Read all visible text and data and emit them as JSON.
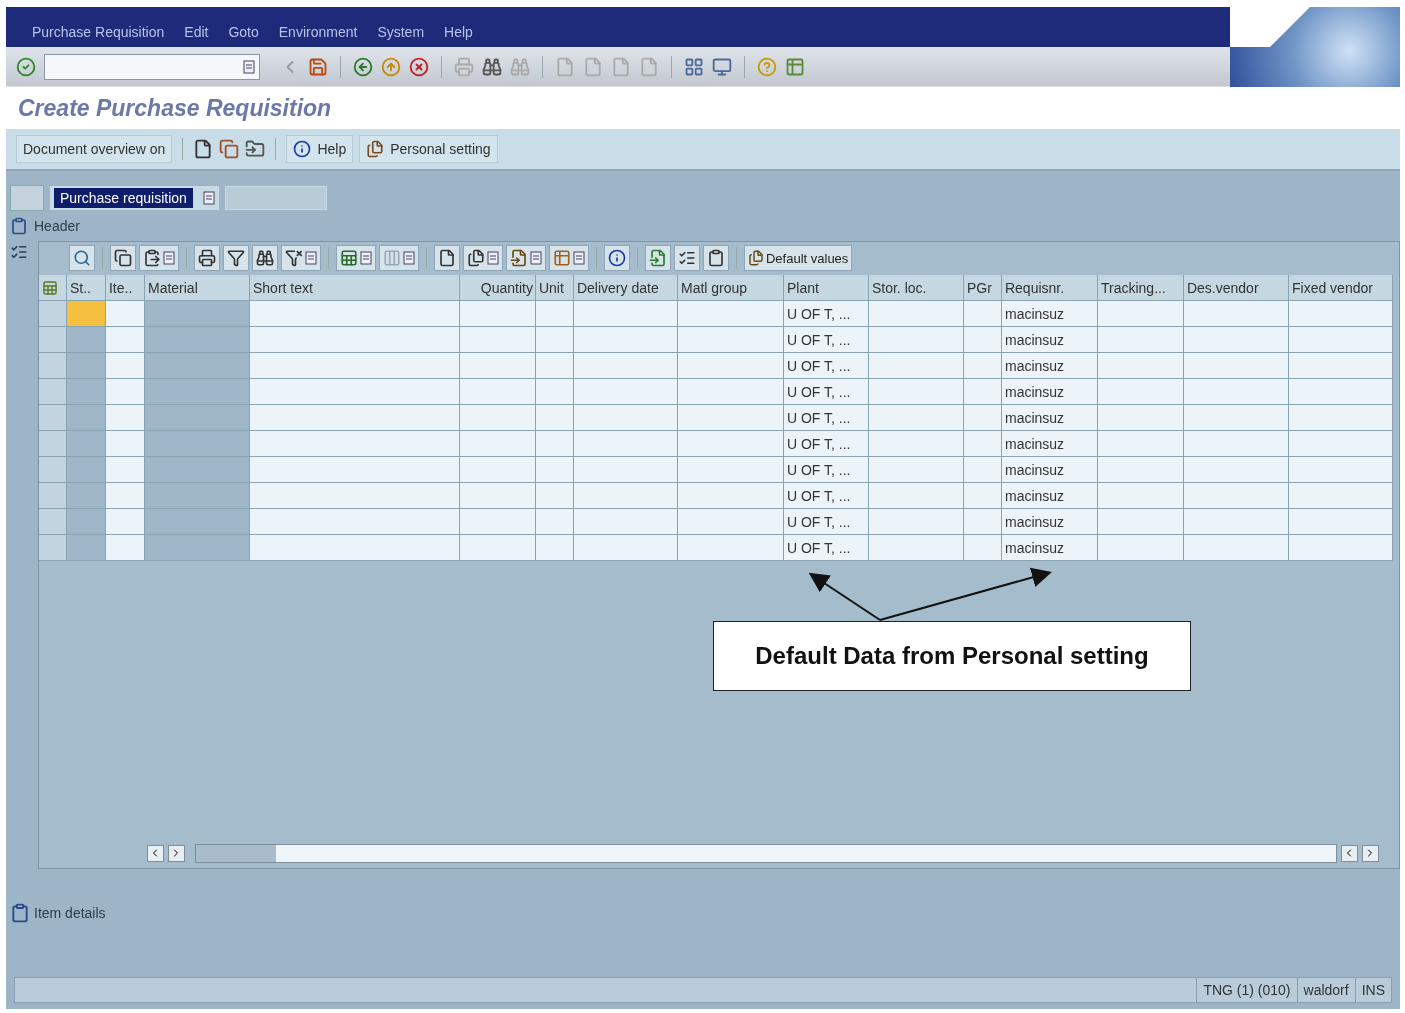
{
  "menu": [
    "Purchase Requisition",
    "Edit",
    "Goto",
    "Environment",
    "System",
    "Help"
  ],
  "title": "Create Purchase Requisition",
  "app_toolbar": {
    "overview_button": "Document overview on",
    "help_button": "Help",
    "personal_button": "Personal setting"
  },
  "document_type": {
    "value": "Purchase requisition"
  },
  "header_label": "Header",
  "table_toolbar": {
    "default_values_button": "Default values"
  },
  "table": {
    "columns": [
      {
        "label": "St..",
        "editable": false,
        "kind": "blank"
      },
      {
        "label": "Ite..",
        "editable": true,
        "kind": "blank"
      },
      {
        "label": "Material",
        "editable": false,
        "kind": "blank"
      },
      {
        "label": "Short text",
        "editable": true,
        "kind": "blank"
      },
      {
        "label": "Quantity",
        "editable": true,
        "kind": "blank"
      },
      {
        "label": "Unit",
        "editable": true,
        "kind": "blank"
      },
      {
        "label": "Delivery date",
        "editable": true,
        "kind": "blank"
      },
      {
        "label": "Matl group",
        "editable": true,
        "kind": "blank"
      },
      {
        "label": "Plant",
        "editable": true,
        "kind": "plant"
      },
      {
        "label": "Stor. loc.",
        "editable": true,
        "kind": "blank"
      },
      {
        "label": "PGr",
        "editable": true,
        "kind": "blank"
      },
      {
        "label": "Requisnr.",
        "editable": true,
        "kind": "requisnr"
      },
      {
        "label": "Tracking...",
        "editable": true,
        "kind": "blank"
      },
      {
        "label": "Des.vendor",
        "editable": true,
        "kind": "blank"
      },
      {
        "label": "Fixed vendor",
        "editable": true,
        "kind": "blank"
      }
    ],
    "rows": [
      {
        "focused": true,
        "plant": "U OF T, ...",
        "requisnr": "macinsuz"
      },
      {
        "focused": false,
        "plant": "U OF T, ...",
        "requisnr": "macinsuz"
      },
      {
        "focused": false,
        "plant": "U OF T, ...",
        "requisnr": "macinsuz"
      },
      {
        "focused": false,
        "plant": "U OF T, ...",
        "requisnr": "macinsuz"
      },
      {
        "focused": false,
        "plant": "U OF T, ...",
        "requisnr": "macinsuz"
      },
      {
        "focused": false,
        "plant": "U OF T, ...",
        "requisnr": "macinsuz"
      },
      {
        "focused": false,
        "plant": "U OF T, ...",
        "requisnr": "macinsuz"
      },
      {
        "focused": false,
        "plant": "U OF T, ...",
        "requisnr": "macinsuz"
      },
      {
        "focused": false,
        "plant": "U OF T, ...",
        "requisnr": "macinsuz"
      },
      {
        "focused": false,
        "plant": "U OF T, ...",
        "requisnr": "macinsuz"
      }
    ]
  },
  "callout": "Default Data from Personal setting",
  "item_details_label": "Item details",
  "status_bar": {
    "system": "TNG (1) (010)",
    "server": "waldorf",
    "mode": "INS"
  }
}
